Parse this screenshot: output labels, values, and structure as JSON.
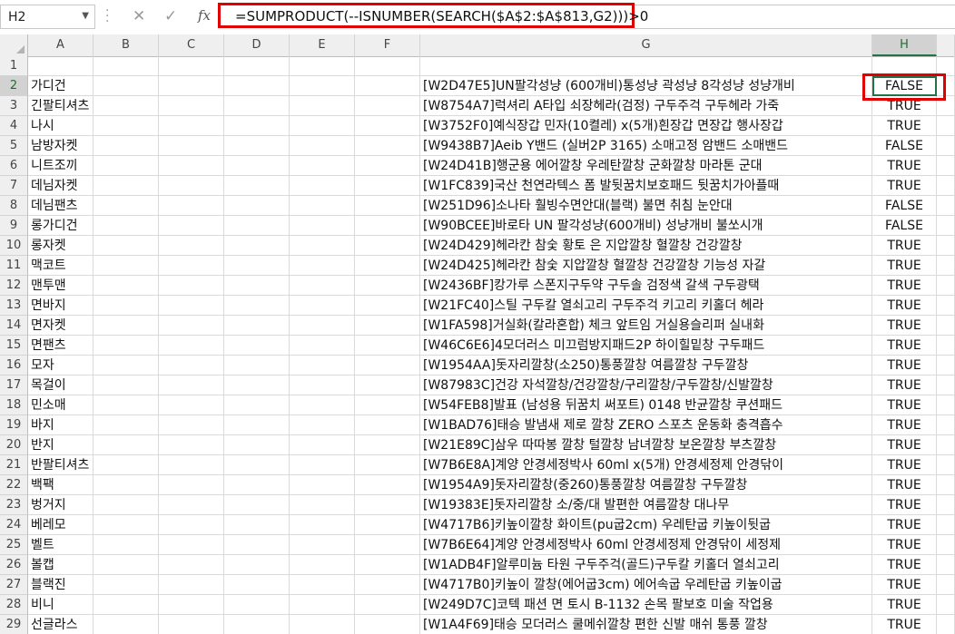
{
  "formula_bar": {
    "name_box": "H2",
    "formula": "=SUMPRODUCT(--ISNUMBER(SEARCH($A$2:$A$813,G2)))>0",
    "fx_label": "fx",
    "cancel_icon": "close-icon",
    "enter_icon": "check-icon"
  },
  "columns": [
    "A",
    "B",
    "C",
    "D",
    "E",
    "F",
    "G",
    "H"
  ],
  "selected_column": "H",
  "selected_row": 2,
  "accent_color": "#217346",
  "highlight_color": "#e10000",
  "rows": [
    {
      "n": "1",
      "a": "",
      "g": "",
      "h": ""
    },
    {
      "n": "2",
      "a": "가디건",
      "g": "[W2D47E5]UN팔각성냥 (600개비)통성냥 곽성냥 8각성냥 성냥개비",
      "h": "FALSE"
    },
    {
      "n": "3",
      "a": "긴팔티셔츠",
      "g": "[W8754A7]럭셔리 A타입 쇠장헤라(검정) 구두주걱 구두헤라 가죽",
      "h": "TRUE"
    },
    {
      "n": "4",
      "a": "나시",
      "g": "[W3752F0]예식장갑 민자(10켤레) x(5개)흰장갑 면장갑 행사장갑",
      "h": "TRUE"
    },
    {
      "n": "5",
      "a": "남방자켓",
      "g": "[W9438B7]Aeib Y밴드 (실버2P 3165) 소매고정 암밴드 소매밴드",
      "h": "FALSE"
    },
    {
      "n": "6",
      "a": "니트조끼",
      "g": "[W24D41B]행군용 에어깔창 우레탄깔창 군화깔창 마라톤 군대",
      "h": "TRUE"
    },
    {
      "n": "7",
      "a": "데님자켓",
      "g": "[W1FC839]국산 천연라텍스 폼 발뒷꿈치보호패드 뒷꿈치가아플때",
      "h": "TRUE"
    },
    {
      "n": "8",
      "a": "데님팬츠",
      "g": "[W251D96]소나타 훨빙수면안대(블랙) 불면 취침 눈안대",
      "h": "FALSE"
    },
    {
      "n": "9",
      "a": "롱가디건",
      "g": "[W90BCEE]바로타 UN 팔각성냥(600개비) 성냥개비 불쏘시개",
      "h": "FALSE"
    },
    {
      "n": "10",
      "a": "롱자켓",
      "g": "[W24D429]헤라칸 참숯 황토 은 지압깔창 혈깔창 건강깔창",
      "h": "TRUE"
    },
    {
      "n": "11",
      "a": "맥코트",
      "g": "[W24D425]헤라칸 참숯 지압깔창 혈깔창 건강깔창 기능성 자갈",
      "h": "TRUE"
    },
    {
      "n": "12",
      "a": "맨투맨",
      "g": "[W2436BF]캉가루 스폰지구두약 구두솔 검정색 갈색 구두광택",
      "h": "TRUE"
    },
    {
      "n": "13",
      "a": "면바지",
      "g": "[W21FC40]스틸 구두칼 열쇠고리 구두주걱 키고리 키홀더 헤라",
      "h": "TRUE"
    },
    {
      "n": "14",
      "a": "면자켓",
      "g": "[W1FA598]거실화(칼라혼합) 체크 앞트임 거실용슬리퍼 실내화",
      "h": "TRUE"
    },
    {
      "n": "15",
      "a": "면팬츠",
      "g": "[W46C6E6]4모더러스 미끄럼방지패드2P 하이힐밑창 구두패드",
      "h": "TRUE"
    },
    {
      "n": "16",
      "a": "모자",
      "g": "[W1954AA]돗자리깔창(소250)통풍깔창 여름깔창 구두깔창",
      "h": "TRUE"
    },
    {
      "n": "17",
      "a": "목걸이",
      "g": "[W87983C]건강 자석깔창/건강깔창/구리깔창/구두깔창/신발깔창",
      "h": "TRUE"
    },
    {
      "n": "18",
      "a": "민소매",
      "g": "[W54FEB8]발표 (남성용 뒤꿈치 써포트) 0148 반균깔창 쿠션패드",
      "h": "TRUE"
    },
    {
      "n": "19",
      "a": "바지",
      "g": "[W1BAD76]태승 발냄새 제로 깔창 ZERO 스포츠 운동화 충격흡수",
      "h": "TRUE"
    },
    {
      "n": "20",
      "a": "반지",
      "g": "[W21E89C]삼우 따따봉 깔창 털깔창 남녀깔창 보온깔창 부츠깔창",
      "h": "TRUE"
    },
    {
      "n": "21",
      "a": "반팔티셔츠",
      "g": "[W7B6E8A]계양 안경세정박사 60ml x(5개) 안경세정제 안경닦이",
      "h": "TRUE"
    },
    {
      "n": "22",
      "a": "백팩",
      "g": "[W1954A9]돗자리깔창(중260)통풍깔창 여름깔창 구두깔창",
      "h": "TRUE"
    },
    {
      "n": "23",
      "a": "벙거지",
      "g": "[W19383E]돗자리깔창 소/중/대 발편한 여름깔창 대나무",
      "h": "TRUE"
    },
    {
      "n": "24",
      "a": "베레모",
      "g": "[W4717B6]키높이깔창 화이트(pu굽2cm) 우레탄굽 키높이뒷굽",
      "h": "TRUE"
    },
    {
      "n": "25",
      "a": "벨트",
      "g": "[W7B6E64]계양 안경세정박사 60ml 안경세정제 안경닦이 세정제",
      "h": "TRUE"
    },
    {
      "n": "26",
      "a": "볼캡",
      "g": "[W1ADB4F]알루미늄 타원 구두주걱(골드)구두칼 키홀더 열쇠고리",
      "h": "TRUE"
    },
    {
      "n": "27",
      "a": "블랙진",
      "g": "[W4717B0]키높이 깔창(에어굽3cm) 에어속굽 우레탄굽 키높이굽",
      "h": "TRUE"
    },
    {
      "n": "28",
      "a": "비니",
      "g": "[W249D7C]코텍 패션 면 토시 B-1132 손목 팔보호 미술 작업용",
      "h": "TRUE"
    },
    {
      "n": "29",
      "a": "선글라스",
      "g": "[W1A4F69]태승 모더러스 쿨메쉬깔창 편한 신발 매쉬 통풍 깔창",
      "h": "TRUE"
    }
  ]
}
